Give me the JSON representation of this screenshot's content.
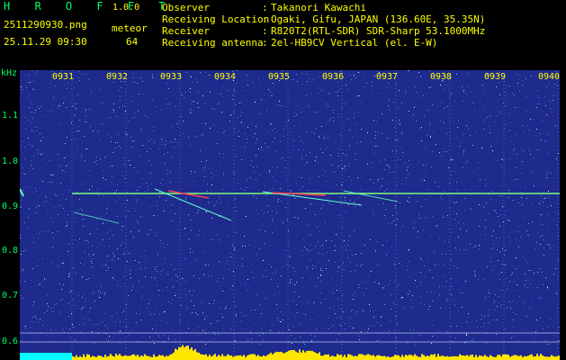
{
  "header": {
    "app_title": "H R O F F T",
    "version": "1.0.0",
    "file_name": "2511290930.png",
    "timestamp": "25.11.29 09:30",
    "meteor_label": "meteor",
    "meteor_count": "64",
    "info": [
      {
        "label": "Observer",
        "colon": ":",
        "value": "Takanori Kawachi"
      },
      {
        "label": "Receiving Location",
        "colon": ":",
        "value": "Ogaki, Gifu, JAPAN (136.60E, 35.35N)"
      },
      {
        "label": "Receiver",
        "colon": ":",
        "value": "R820T2(RTL-SDR) SDR-Sharp 53.1000MHz"
      },
      {
        "label": "Receiving antenna",
        "colon": ":",
        "value": "2el-HB9CV Vertical (el. E-W)"
      }
    ]
  },
  "axes": {
    "y_title": "kHz",
    "y_ticks": [
      "1.1",
      "1.0",
      "0.9",
      "0.8",
      "0.7",
      "0.6"
    ],
    "x_ticks": [
      "0931",
      "0932",
      "0933",
      "0934",
      "0935",
      "0936",
      "0937",
      "0938",
      "0939",
      "0940"
    ]
  },
  "colors": {
    "background": "#1e2a8c",
    "label_yellow": "#ffff00",
    "label_green": "#00ff66",
    "carrier": "#7dff7d",
    "meteor_head": "#ff3b5c",
    "noise_floor": "#ffe600",
    "baseline_cyan": "#00ffff"
  }
}
